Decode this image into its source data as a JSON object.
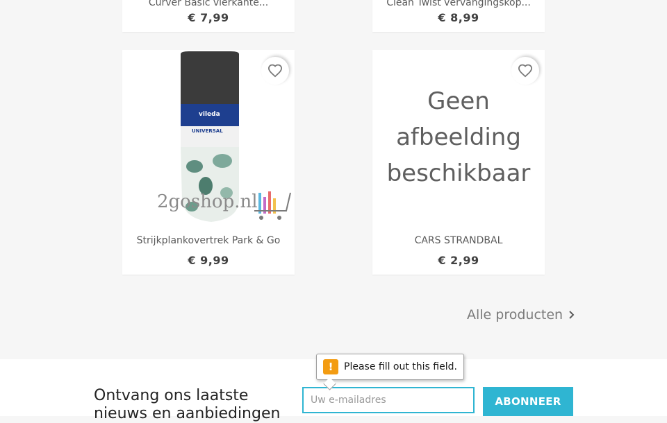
{
  "products_top": [
    {
      "name": "Curver Basic vierkante...",
      "price": "€ 7,99"
    },
    {
      "name": "Clean Twist vervangingskop...",
      "price": "€ 8,99"
    }
  ],
  "products": [
    {
      "name": "Strijkplankovertrek Park & Go",
      "price": "€ 9,99",
      "image": {
        "brand": "vileda",
        "cover_label": "UNIVERSAL",
        "watermark": "2goshop.nl"
      }
    },
    {
      "name": "CARS STRANDBAL",
      "price": "€ 2,99",
      "image": {
        "placeholder_lines": [
          "Geen",
          "afbeelding",
          "beschikbaar"
        ]
      }
    }
  ],
  "all_products_link": "Alle producten",
  "newsletter": {
    "heading_line1": "Ontvang ons laatste",
    "heading_line2": "nieuws en aanbiedingen",
    "email_placeholder": "Uw e-mailadres",
    "subscribe_label": "ABONNEER"
  },
  "validation_tooltip": {
    "message": "Please fill out this field.",
    "icon": "!"
  },
  "colors": {
    "accent": "#2fb5d2",
    "warning": "#f39c12"
  }
}
